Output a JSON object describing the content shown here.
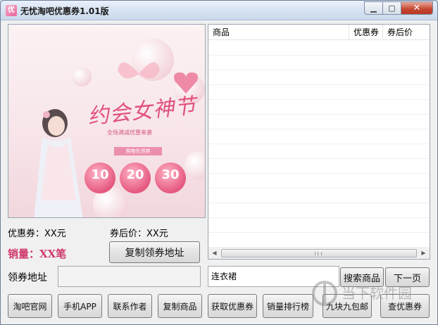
{
  "window": {
    "title": "无忧淘吧优惠券1.01版",
    "min_label": "▁",
    "max_label": "▢",
    "close_label": "✕"
  },
  "poster": {
    "headline": "约会女神节",
    "subtitle": "全场满减优惠来袭",
    "tag": "购物先领券",
    "coupons": [
      "10",
      "20",
      "30"
    ]
  },
  "info": {
    "coupon_label": "优惠券：XX元",
    "after_price_label": "券后价：XX元",
    "sales_label": "销量：XX笔",
    "copy_coupon_url_button": "复制领券地址",
    "coupon_url_label": "领券地址",
    "coupon_url_value": ""
  },
  "list": {
    "columns": [
      "商品",
      "优惠券",
      "券后价"
    ],
    "rows": []
  },
  "search": {
    "value": "连衣裙",
    "search_button": "搜索商品",
    "next_page_button": "下一页"
  },
  "bottom_buttons": [
    "淘吧官网",
    "手机APP",
    "联系作者",
    "复制商品",
    "获取优惠券",
    "销量排行榜",
    "九块九包邮",
    "查优惠券"
  ],
  "watermark": "当下软件园",
  "colors": {
    "sales": "#d0386a",
    "accent_pink": "#e0517c"
  }
}
